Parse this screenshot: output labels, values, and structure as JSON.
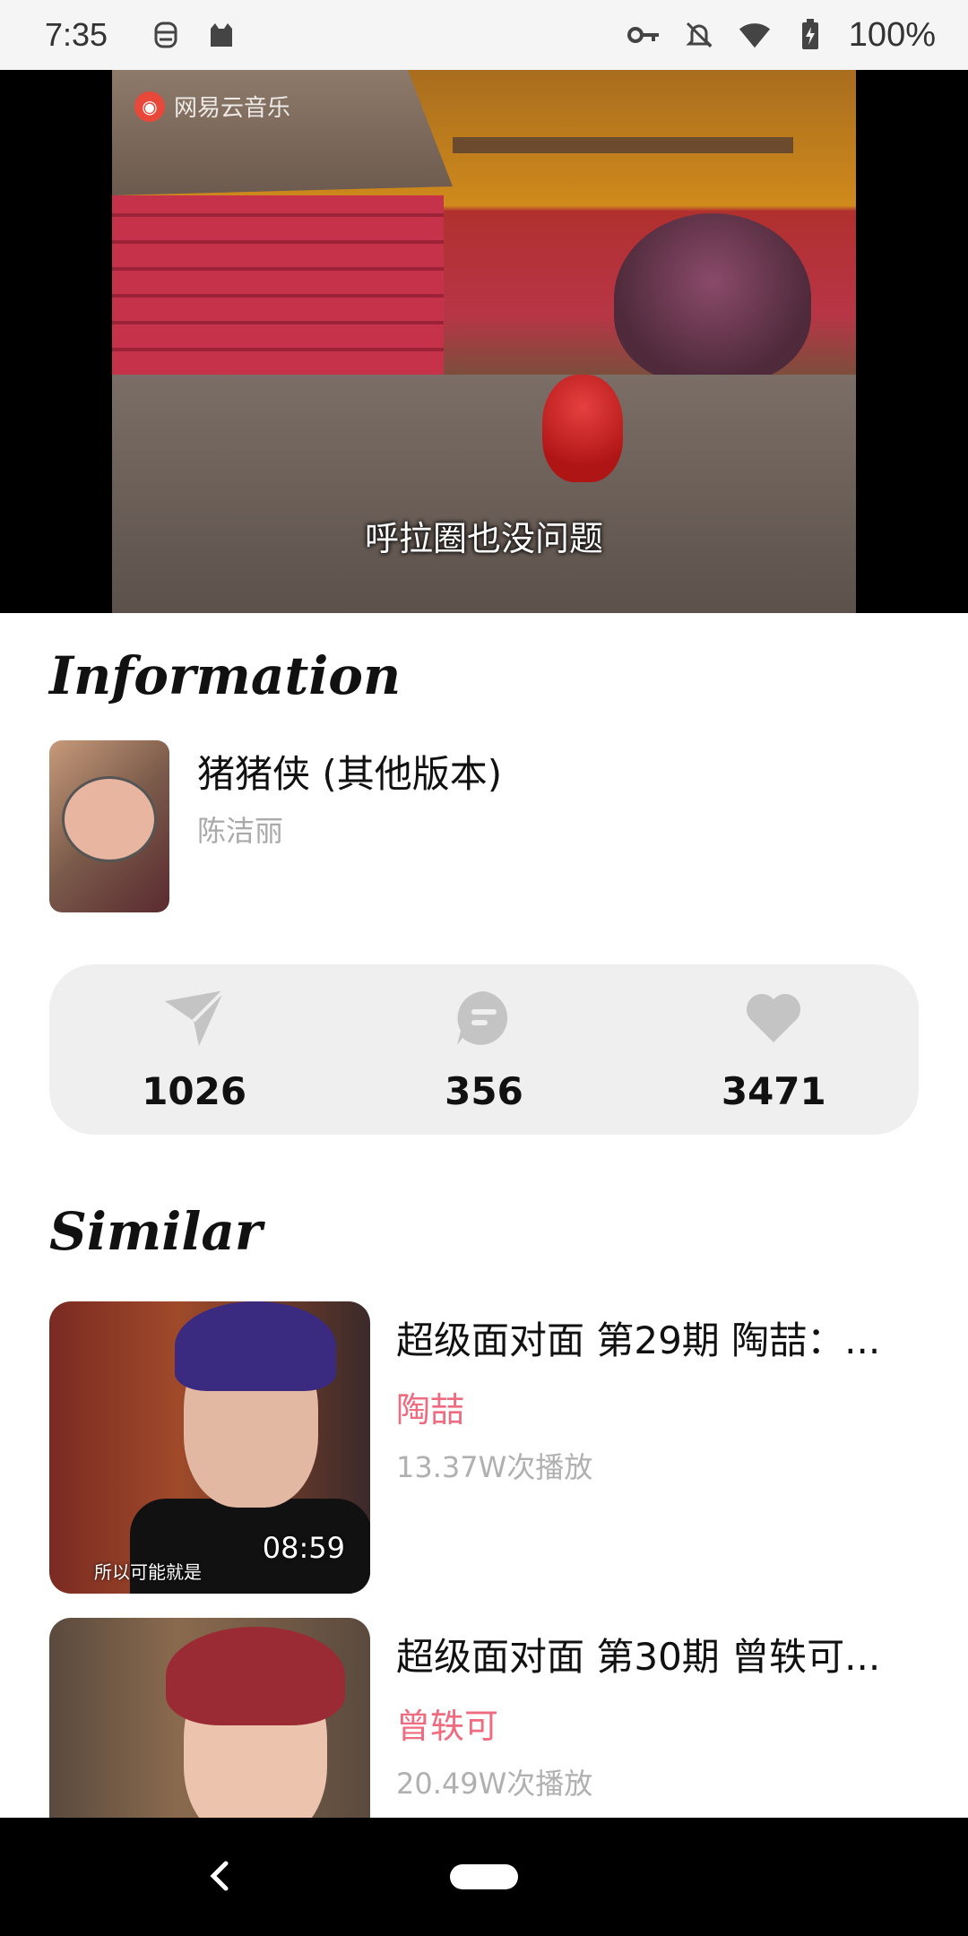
{
  "status_bar": {
    "time": "7:35",
    "battery": "100%",
    "icons": [
      "face-icon",
      "cat-icon",
      "key-icon",
      "notifications-off-icon",
      "wifi-icon",
      "battery-charging-icon"
    ]
  },
  "video": {
    "watermark": "网易云音乐",
    "subtitle": "呼拉圈也没问题"
  },
  "information": {
    "heading": "Information",
    "title": "猪猪侠 (其他版本)",
    "artist": "陈洁丽"
  },
  "stats": {
    "shares": "1026",
    "comments": "356",
    "likes": "3471"
  },
  "similar": {
    "heading": "Similar",
    "items": [
      {
        "title": "超级面对面 第29期 陶喆：...",
        "artist": "陶喆",
        "plays": "13.37W次播放",
        "duration": "08:59",
        "caption": "所以可能就是"
      },
      {
        "title": "超级面对面 第30期 曾轶可...",
        "artist": "曾轶可",
        "plays": "20.49W次播放"
      }
    ]
  },
  "colors": {
    "accent_pink": "#ee6b80",
    "stats_bg": "#efefef",
    "muted_text": "#aaaaaa"
  }
}
